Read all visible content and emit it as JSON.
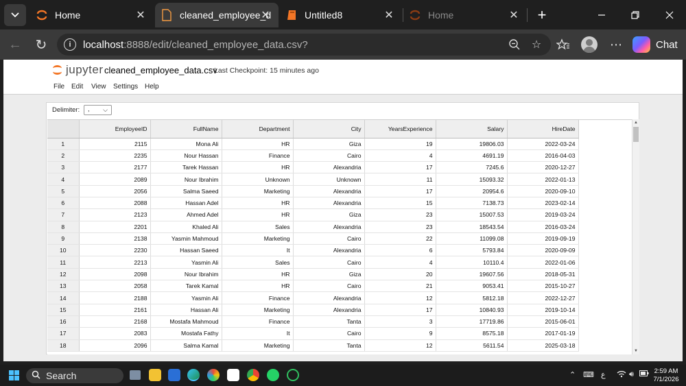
{
  "browser": {
    "tabs": [
      {
        "title": "Home",
        "active": false,
        "dim": false
      },
      {
        "title": "cleaned_employee_d",
        "active": true,
        "dim": false
      },
      {
        "title": "Untitled8",
        "active": false,
        "dim": false
      },
      {
        "title": "Home",
        "active": false,
        "dim": true
      }
    ],
    "url_host": "localhost",
    "url_rest": ":8888/edit/cleaned_employee_data.csv?",
    "chat_label": "Chat"
  },
  "jupyter": {
    "logo_text": "jupyter",
    "filename": "cleaned_employee_data.csv",
    "checkpoint": "Last Checkpoint: 15 minutes ago",
    "menu": [
      "File",
      "Edit",
      "View",
      "Settings",
      "Help"
    ]
  },
  "csv_viewer": {
    "delimiter_label": "Delimiter:",
    "delimiter_value": ",",
    "columns": [
      "EmployeeID",
      "FullName",
      "Department",
      "City",
      "YearsExperience",
      "Salary",
      "HireDate"
    ],
    "rows": [
      [
        "1",
        "2115",
        "Mona Ali",
        "HR",
        "Giza",
        "19",
        "19806.03",
        "2022-03-24"
      ],
      [
        "2",
        "2235",
        "Nour Hassan",
        "Finance",
        "Cairo",
        "4",
        "4691.19",
        "2016-04-03"
      ],
      [
        "3",
        "2177",
        "Tarek Hassan",
        "HR",
        "Alexandria",
        "17",
        "7245.6",
        "2020-12-27"
      ],
      [
        "4",
        "2089",
        "Nour Ibrahim",
        "Unknown",
        "Unknown",
        "11",
        "15093.32",
        "2022-01-13"
      ],
      [
        "5",
        "2056",
        "Salma Saeed",
        "Marketing",
        "Alexandria",
        "17",
        "20954.6",
        "2020-09-10"
      ],
      [
        "6",
        "2088",
        "Hassan Adel",
        "HR",
        "Alexandria",
        "15",
        "7138.73",
        "2023-02-14"
      ],
      [
        "7",
        "2123",
        "Ahmed Adel",
        "HR",
        "Giza",
        "23",
        "15007.53",
        "2019-03-24"
      ],
      [
        "8",
        "2201",
        "Khaled Ali",
        "Sales",
        "Alexandria",
        "23",
        "18543.54",
        "2016-03-24"
      ],
      [
        "9",
        "2138",
        "Yasmin Mahmoud",
        "Marketing",
        "Cairo",
        "22",
        "11099.08",
        "2019-09-19"
      ],
      [
        "10",
        "2230",
        "Hassan Saeed",
        "It",
        "Alexandria",
        "6",
        "5793.84",
        "2020-09-09"
      ],
      [
        "11",
        "2213",
        "Yasmin Ali",
        "Sales",
        "Cairo",
        "4",
        "10110.4",
        "2022-01-06"
      ],
      [
        "12",
        "2098",
        "Nour Ibrahim",
        "HR",
        "Giza",
        "20",
        "19607.56",
        "2018-05-31"
      ],
      [
        "13",
        "2058",
        "Tarek Kamal",
        "HR",
        "Cairo",
        "21",
        "9053.41",
        "2015-10-27"
      ],
      [
        "14",
        "2188",
        "Yasmin Ali",
        "Finance",
        "Alexandria",
        "12",
        "5812.18",
        "2022-12-27"
      ],
      [
        "15",
        "2161",
        "Hassan Ali",
        "Marketing",
        "Alexandria",
        "17",
        "10840.93",
        "2019-10-14"
      ],
      [
        "16",
        "2168",
        "Mostafa Mahmoud",
        "Finance",
        "Tanta",
        "3",
        "17719.86",
        "2015-06-01"
      ],
      [
        "17",
        "2083",
        "Mostafa Fathy",
        "It",
        "Cairo",
        "9",
        "8575.18",
        "2017-01-19"
      ],
      [
        "18",
        "2096",
        "Salma Kamal",
        "Marketing",
        "Tanta",
        "12",
        "5611.54",
        "2025-03-18"
      ]
    ]
  },
  "taskbar": {
    "search_label": "Search",
    "lang": "ع",
    "time": "2:59 AM",
    "date": "7/1/2026"
  },
  "colors": {
    "jupyter_orange": "#f37626",
    "windows_blue": "#4cc2ff"
  }
}
